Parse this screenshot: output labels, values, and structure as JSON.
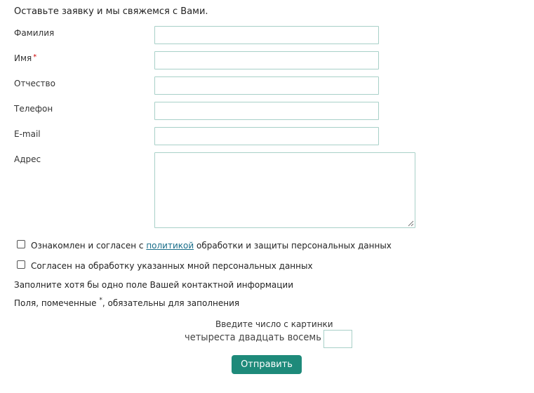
{
  "form": {
    "intro": "Оставьте заявку и мы свяжемся с Вами.",
    "fields": {
      "last_name": {
        "label": "Фамилия",
        "value": ""
      },
      "first_name": {
        "label": "Имя",
        "required_mark": "*",
        "value": ""
      },
      "patronymic": {
        "label": "Отчество",
        "value": ""
      },
      "phone": {
        "label": "Телефон",
        "value": ""
      },
      "email": {
        "label": "E-mail",
        "value": ""
      },
      "address": {
        "label": "Адрес",
        "value": ""
      }
    },
    "consents": {
      "policy": {
        "checked": false,
        "text_before": "Ознакомлен и согласен с ",
        "link_text": "политикой",
        "text_after": " обработки и защиты персональных данных"
      },
      "processing": {
        "checked": false,
        "text": "Согласен на обработку указанных мной персональных данных"
      }
    },
    "notes": {
      "contact_hint": "Заполните хотя бы одно поле Вашей контактной информации",
      "required_hint_before": "Поля, помеченные ",
      "required_hint_star": "*",
      "required_hint_after": ", обязательны для заполнения"
    },
    "captcha": {
      "caption": "Введите число с картинки",
      "image_text": "четыреста двадцать восемь",
      "value": ""
    },
    "submit_label": "Отправить"
  },
  "colors": {
    "accent": "#1e8a7a",
    "input_border": "#a8d0c8",
    "link": "#1a6e8a",
    "required": "#cc0000"
  }
}
